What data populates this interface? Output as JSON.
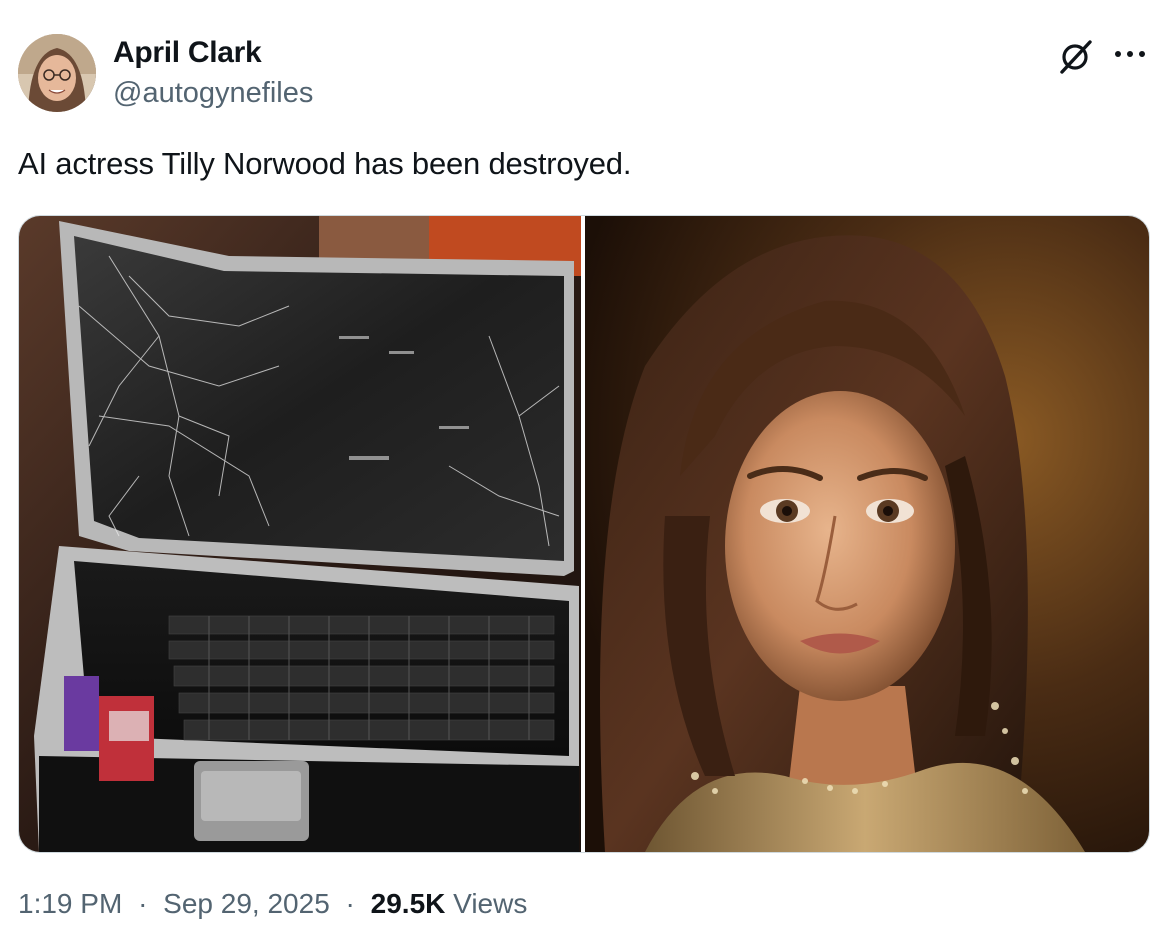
{
  "author": {
    "display_name": "April Clark",
    "handle": "@autogynefiles"
  },
  "header_icons": [
    "grok-icon",
    "more-options-icon"
  ],
  "tweet": {
    "text": "AI actress Tilly Norwood has been destroyed."
  },
  "media": {
    "count": 2,
    "images": [
      "smashed-laptop-photo",
      "woman-portrait-photo"
    ]
  },
  "meta": {
    "time": "1:19 PM",
    "separator": "·",
    "date": "Sep 29, 2025",
    "views_count": "29.5K",
    "views_label": "Views"
  },
  "colors": {
    "text_primary": "#0f1419",
    "text_secondary": "#536471",
    "border": "#cfd9de"
  }
}
